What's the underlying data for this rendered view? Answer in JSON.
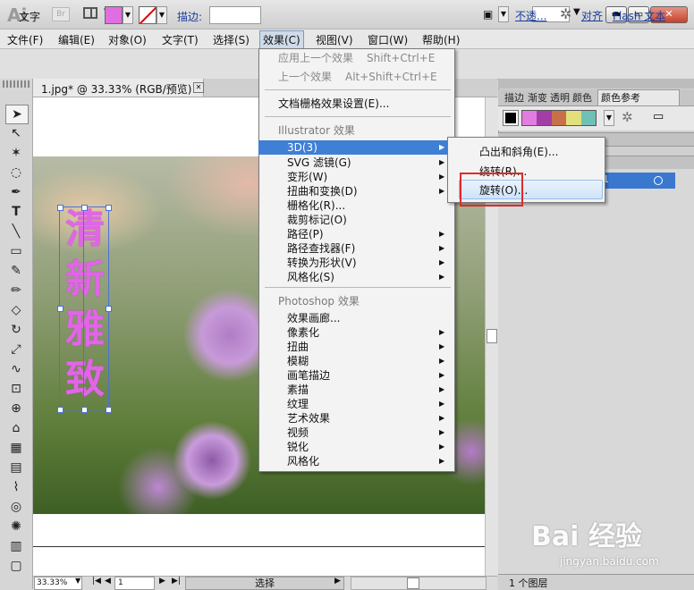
{
  "app": {
    "logo": "Ai",
    "bridge": "Br"
  },
  "window_controls": {
    "minimize": "▬",
    "maximize": "▭",
    "close": "✕"
  },
  "menubar": [
    "文件(F)",
    "编辑(E)",
    "对象(O)",
    "文字(T)",
    "选择(S)",
    "效果(C)",
    "视图(V)",
    "窗口(W)",
    "帮助(H)"
  ],
  "controlbar": {
    "tool_label": "文字",
    "fill_color": "#e16ee0",
    "stroke_label": "描边:",
    "opacity_link": "不透...",
    "align_link": "对齐",
    "flash_link": "Flash 文本"
  },
  "document": {
    "tab_title": "1.jpg* @ 33.33% (RGB/预览)",
    "vertical_text": [
      "清",
      "新",
      "雅",
      "致"
    ],
    "text_color": "#e066e6"
  },
  "statusbar": {
    "zoom": "33.33%",
    "page": "1",
    "mode": "选择"
  },
  "right_panel": {
    "tabs": [
      "描边",
      "渐变",
      "透明",
      "颜色"
    ],
    "active_tab": "颜色参考",
    "swatches": [
      "#e27ce1",
      "#a33ea6",
      "#c9704a",
      "#e2e07c",
      "#6ec1b4"
    ],
    "layer_suffix": "1",
    "layer_count": "1 个图层"
  },
  "effect_menu": {
    "items": [
      {
        "label": "应用上一个效果",
        "shortcut": "Shift+Ctrl+E",
        "disabled": true
      },
      {
        "label": "上一个效果",
        "shortcut": "Alt+Shift+Ctrl+E",
        "disabled": true
      },
      {
        "label": "文档栅格效果设置(E)..."
      },
      {
        "header": "Illustrator 效果"
      },
      {
        "label": "3D(3)",
        "submenu": true,
        "highlighted": true
      },
      {
        "label": "SVG 滤镜(G)",
        "submenu": true
      },
      {
        "label": "变形(W)",
        "submenu": true
      },
      {
        "label": "扭曲和变换(D)",
        "submenu": true
      },
      {
        "label": "栅格化(R)..."
      },
      {
        "label": "裁剪标记(O)"
      },
      {
        "label": "路径(P)",
        "submenu": true
      },
      {
        "label": "路径查找器(F)",
        "submenu": true
      },
      {
        "label": "转换为形状(V)",
        "submenu": true
      },
      {
        "label": "风格化(S)",
        "submenu": true
      },
      {
        "header": "Photoshop 效果"
      },
      {
        "label": "效果画廊..."
      },
      {
        "label": "像素化",
        "submenu": true
      },
      {
        "label": "扭曲",
        "submenu": true
      },
      {
        "label": "模糊",
        "submenu": true
      },
      {
        "label": "画笔描边",
        "submenu": true
      },
      {
        "label": "素描",
        "submenu": true
      },
      {
        "label": "纹理",
        "submenu": true
      },
      {
        "label": "艺术效果",
        "submenu": true
      },
      {
        "label": "视频",
        "submenu": true
      },
      {
        "label": "锐化",
        "submenu": true
      },
      {
        "label": "风格化",
        "submenu": true
      }
    ]
  },
  "submenu_3d": [
    "凸出和斜角(E)...",
    "绕转(R)...",
    "旋转(O)..."
  ],
  "watermark": {
    "brand": "Bai 经验",
    "url": "jingyan.baidu.com"
  }
}
